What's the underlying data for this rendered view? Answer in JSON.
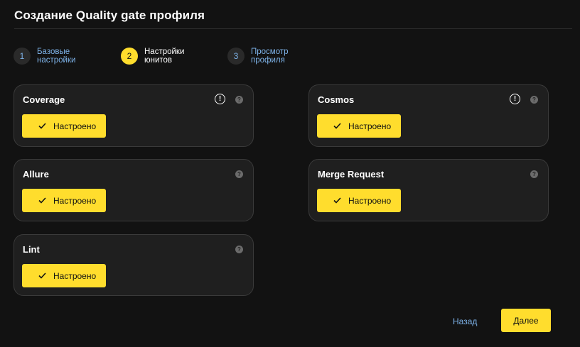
{
  "page": {
    "title": "Создание Quality gate профиля"
  },
  "stepper": {
    "steps": [
      {
        "number": "1",
        "label": "Базовые настройки",
        "state": "done"
      },
      {
        "number": "2",
        "label": "Настройки юнитов",
        "state": "active"
      },
      {
        "number": "3",
        "label": "Просмотр профиля",
        "state": "upcoming"
      }
    ]
  },
  "units": [
    {
      "title": "Coverage",
      "status_label": "Настроено",
      "has_warning": true
    },
    {
      "title": "Cosmos",
      "status_label": "Настроено",
      "has_warning": true
    },
    {
      "title": "Allure",
      "status_label": "Настроено",
      "has_warning": false
    },
    {
      "title": "Merge Request",
      "status_label": "Настроено",
      "has_warning": false
    },
    {
      "title": "Lint",
      "status_label": "Настроено",
      "has_warning": false
    }
  ],
  "icons": {
    "warning": "exclamation-circle-icon",
    "help": "question-circle-icon",
    "check": "check-icon",
    "warning_glyph": "!",
    "help_glyph": "?"
  },
  "footer": {
    "back_label": "Назад",
    "next_label": "Далее"
  },
  "colors": {
    "background": "#121212",
    "card": "#1f1f1f",
    "accent": "#ffdd2d",
    "link": "#7db2e8"
  }
}
